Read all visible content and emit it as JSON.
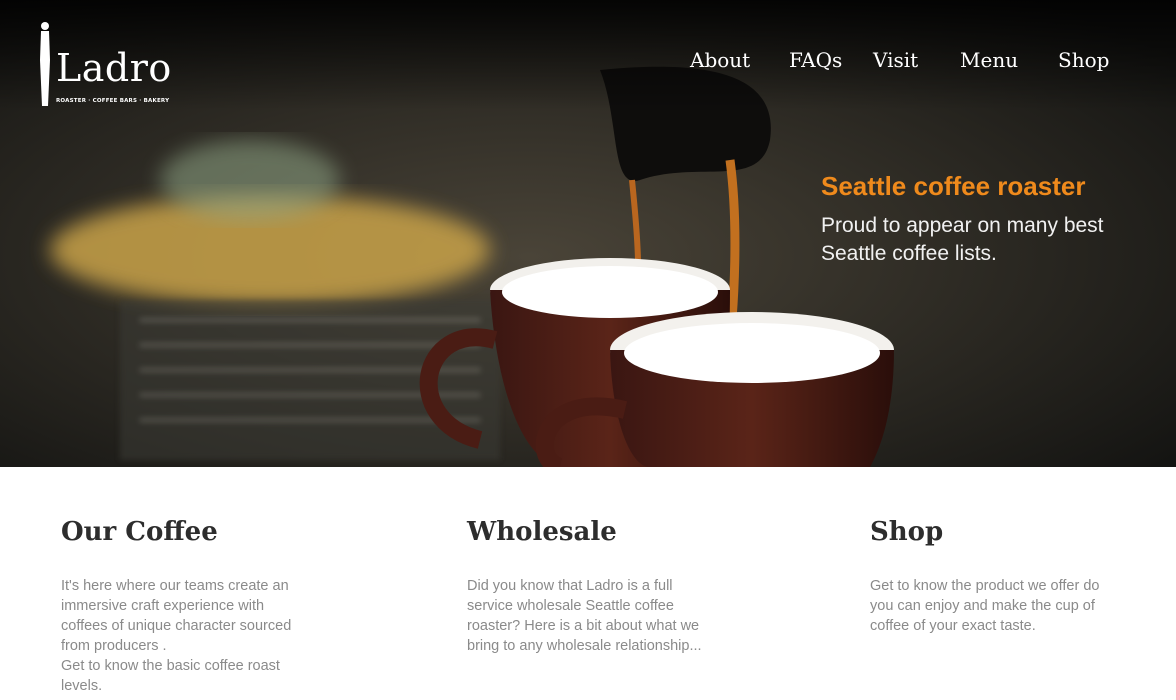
{
  "brand": {
    "name": "Ladro",
    "tagline": "ROASTER · COFFEE BARS · BAKERY"
  },
  "nav": {
    "items": [
      "About",
      "FAQs",
      "Visit",
      "Menu",
      "Shop"
    ]
  },
  "hero": {
    "title": "Seattle coffee roaster",
    "subtitle_lines": [
      "Proud to appear on many best",
      "Seattle coffee lists."
    ]
  },
  "sections": [
    {
      "heading": "Our Coffee",
      "lines": [
        "It's here where our teams create an",
        "immersive craft experience with",
        "coffees of unique character sourced",
        "from producers .",
        "Get to know the basic coffee roast",
        "levels."
      ]
    },
    {
      "heading": "Wholesale",
      "lines": [
        "Did you know that Ladro is a full",
        "service wholesale Seattle coffee",
        "roaster? Here is a bit about what we",
        "bring to any wholesale relationship..."
      ]
    },
    {
      "heading": "Shop",
      "lines": [
        "Get to know the product we offer do",
        "you can enjoy and make the cup of",
        "coffee of your exact taste."
      ]
    }
  ],
  "colors": {
    "accent": "#ef8a1c",
    "heading": "#2d2d2d",
    "body_text": "#8a8a8a"
  }
}
